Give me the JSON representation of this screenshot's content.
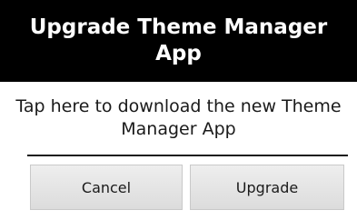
{
  "dialog": {
    "title": "Upgrade Theme Manager App",
    "message": "Tap here to download the new Theme Manager App",
    "buttons": {
      "cancel_label": "Cancel",
      "upgrade_label": "Upgrade"
    }
  },
  "colors": {
    "title_background": "#000000",
    "title_text": "#ffffff",
    "body_background": "#ffffff",
    "button_background": "#e5e5e5"
  }
}
